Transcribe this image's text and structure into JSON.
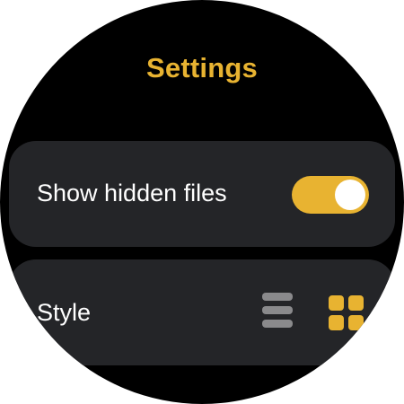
{
  "header": {
    "title": "Settings"
  },
  "settings": {
    "show_hidden_files": {
      "label": "Show hidden files",
      "enabled": true
    },
    "style": {
      "label": "Style",
      "options": [
        "list-icon",
        "grid-icon"
      ],
      "selected": "grid-icon"
    }
  },
  "colors": {
    "accent": "#e8b331",
    "background": "#000000",
    "card": "#242528",
    "text": "#ffffff",
    "inactive_icon": "#8a8a8c"
  }
}
